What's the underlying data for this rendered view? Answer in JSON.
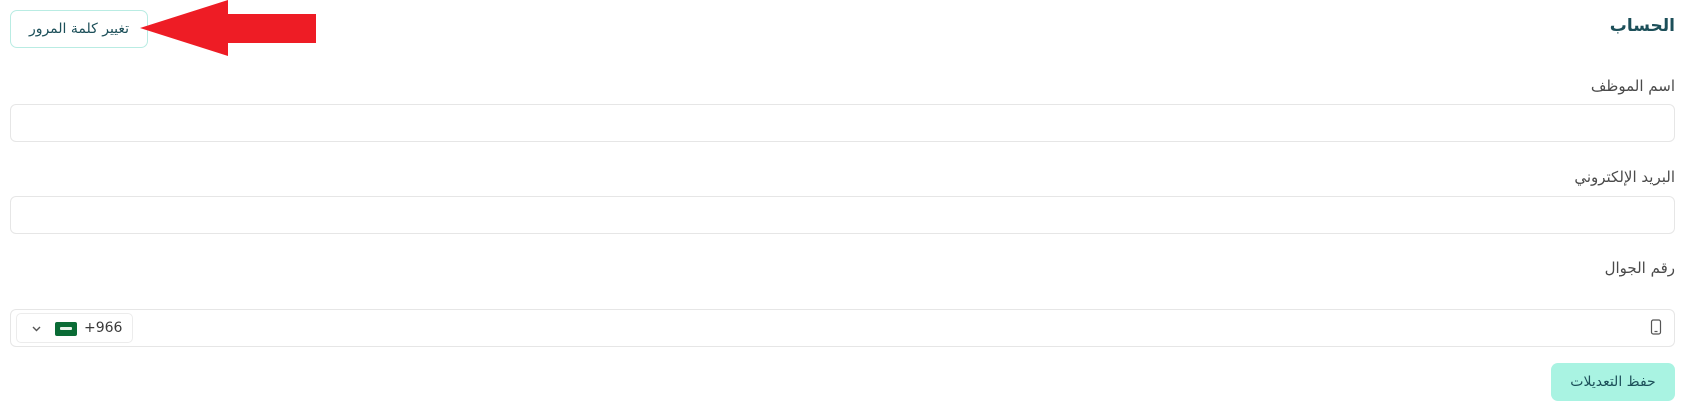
{
  "header": {
    "title": "الحساب",
    "change_password_label": "تغيير كلمة المرور"
  },
  "form": {
    "employee_name": {
      "label": "اسم الموظف",
      "value": "",
      "placeholder": ""
    },
    "email": {
      "label": "البريد الإلكتروني",
      "value": "",
      "placeholder": ""
    },
    "mobile": {
      "label": "رقم الجوال",
      "value": "",
      "placeholder": "",
      "country_dial_code": "+966",
      "country_flag": "saudi-arabia-flag"
    },
    "save_label": "حفظ التعديلات"
  },
  "icons": {
    "dropdown": "chevron-down-icon",
    "mobile": "mobile-phone-icon",
    "annotation": "red-arrow-icon"
  },
  "colors": {
    "accent": "#a9f3e2",
    "accent_border": "#b9ece3",
    "title_text": "#1c4f59",
    "annotation_arrow": "#ee1c25",
    "flag_green": "#0a6b35"
  }
}
